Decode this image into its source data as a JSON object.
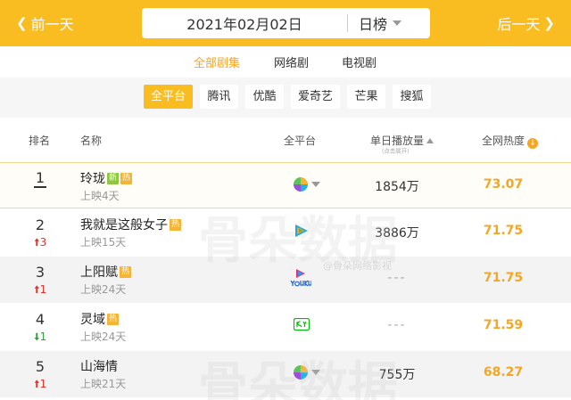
{
  "header": {
    "prev_label": "前一天",
    "next_label": "后一天",
    "date": "2021年02月02日",
    "period": "日榜"
  },
  "tabs": [
    {
      "label": "全部剧集",
      "active": true
    },
    {
      "label": "网络剧",
      "active": false
    },
    {
      "label": "电视剧",
      "active": false
    }
  ],
  "platforms": [
    {
      "label": "全平台",
      "active": true
    },
    {
      "label": "腾讯",
      "active": false
    },
    {
      "label": "优酷",
      "active": false
    },
    {
      "label": "爱奇艺",
      "active": false
    },
    {
      "label": "芒果",
      "active": false
    },
    {
      "label": "搜狐",
      "active": false
    }
  ],
  "columns": {
    "rank": "排名",
    "name": "名称",
    "platform": "全平台",
    "plays": "单日播放量",
    "plays_hint": "(点击展开)",
    "heat": "全网热度"
  },
  "rows": [
    {
      "rank": "1",
      "change": "",
      "title": "玲珑",
      "badges": [
        "新",
        "热"
      ],
      "released": "上映4天",
      "platform_icon": "multi-platform-icon",
      "plays": "1854万",
      "heat": "73.07"
    },
    {
      "rank": "2",
      "change": "3",
      "direction": "up",
      "title": "我就是这般女子",
      "badges": [
        "热"
      ],
      "released": "上映15天",
      "platform_icon": "tencent-video-icon",
      "plays": "3886万",
      "heat": "71.75"
    },
    {
      "rank": "3",
      "change": "1",
      "direction": "up",
      "title": "上阳赋",
      "badges": [
        "热"
      ],
      "released": "上映24天",
      "platform_icon": "youku-icon",
      "plays": "---",
      "heat": "71.75"
    },
    {
      "rank": "4",
      "change": "1",
      "direction": "down",
      "title": "灵域",
      "badges": [
        "热"
      ],
      "released": "上映24天",
      "platform_icon": "iqiyi-icon",
      "plays": "---",
      "heat": "71.59"
    },
    {
      "rank": "5",
      "change": "1",
      "direction": "up",
      "title": "山海情",
      "badges": [],
      "released": "上映21天",
      "platform_icon": "multi-platform-icon",
      "plays": "755万",
      "heat": "68.27"
    }
  ],
  "watermark": {
    "text": "骨朵数据",
    "sub": "@骨朵网络影视"
  },
  "colors": {
    "brand": "#f9bc21",
    "accent": "#f5a623",
    "up": "#e0322b",
    "down": "#2e9e3b"
  }
}
